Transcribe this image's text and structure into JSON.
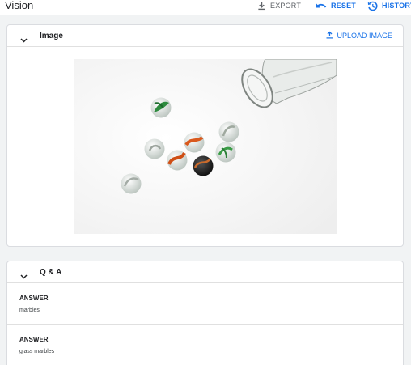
{
  "app": {
    "title": "Vision"
  },
  "toolbar": {
    "export_label": "EXPORT",
    "reset_label": "RESET",
    "history_label": "HISTORY"
  },
  "image_panel": {
    "title": "Image",
    "upload_label": "UPLOAD IMAGE",
    "expanded": true
  },
  "qa_panel": {
    "title": "Q & A",
    "expanded": true,
    "items": [
      {
        "label": "ANSWER",
        "value": "marbles"
      },
      {
        "label": "ANSWER",
        "value": "glass marbles"
      }
    ]
  },
  "colors": {
    "accent": "#1a73e8",
    "muted": "#5f6368",
    "border": "#dadce0",
    "background": "#f1f3f4"
  },
  "icons": [
    "download-icon",
    "undo-icon",
    "history-icon",
    "chevron-down-icon",
    "upload-icon"
  ]
}
